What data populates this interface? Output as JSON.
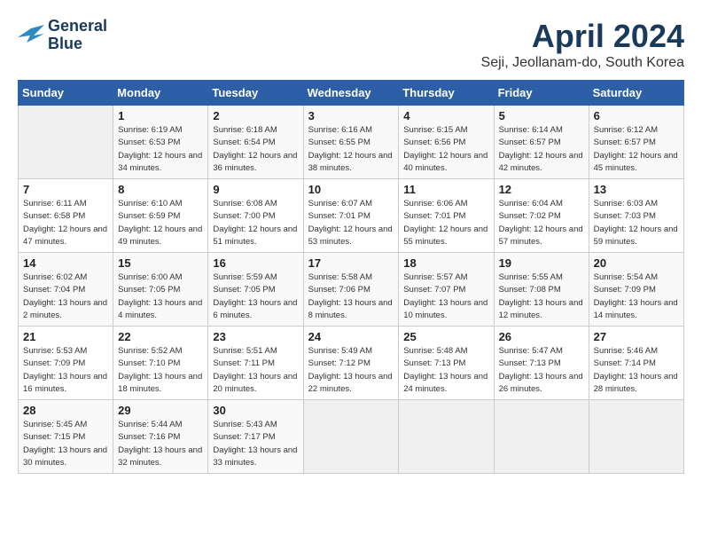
{
  "header": {
    "logo_line1": "General",
    "logo_line2": "Blue",
    "title": "April 2024",
    "location": "Seji, Jeollanam-do, South Korea"
  },
  "weekdays": [
    "Sunday",
    "Monday",
    "Tuesday",
    "Wednesday",
    "Thursday",
    "Friday",
    "Saturday"
  ],
  "weeks": [
    [
      {
        "day": "",
        "sunrise": "",
        "sunset": "",
        "daylight": ""
      },
      {
        "day": "1",
        "sunrise": "Sunrise: 6:19 AM",
        "sunset": "Sunset: 6:53 PM",
        "daylight": "Daylight: 12 hours and 34 minutes."
      },
      {
        "day": "2",
        "sunrise": "Sunrise: 6:18 AM",
        "sunset": "Sunset: 6:54 PM",
        "daylight": "Daylight: 12 hours and 36 minutes."
      },
      {
        "day": "3",
        "sunrise": "Sunrise: 6:16 AM",
        "sunset": "Sunset: 6:55 PM",
        "daylight": "Daylight: 12 hours and 38 minutes."
      },
      {
        "day": "4",
        "sunrise": "Sunrise: 6:15 AM",
        "sunset": "Sunset: 6:56 PM",
        "daylight": "Daylight: 12 hours and 40 minutes."
      },
      {
        "day": "5",
        "sunrise": "Sunrise: 6:14 AM",
        "sunset": "Sunset: 6:57 PM",
        "daylight": "Daylight: 12 hours and 42 minutes."
      },
      {
        "day": "6",
        "sunrise": "Sunrise: 6:12 AM",
        "sunset": "Sunset: 6:57 PM",
        "daylight": "Daylight: 12 hours and 45 minutes."
      }
    ],
    [
      {
        "day": "7",
        "sunrise": "Sunrise: 6:11 AM",
        "sunset": "Sunset: 6:58 PM",
        "daylight": "Daylight: 12 hours and 47 minutes."
      },
      {
        "day": "8",
        "sunrise": "Sunrise: 6:10 AM",
        "sunset": "Sunset: 6:59 PM",
        "daylight": "Daylight: 12 hours and 49 minutes."
      },
      {
        "day": "9",
        "sunrise": "Sunrise: 6:08 AM",
        "sunset": "Sunset: 7:00 PM",
        "daylight": "Daylight: 12 hours and 51 minutes."
      },
      {
        "day": "10",
        "sunrise": "Sunrise: 6:07 AM",
        "sunset": "Sunset: 7:01 PM",
        "daylight": "Daylight: 12 hours and 53 minutes."
      },
      {
        "day": "11",
        "sunrise": "Sunrise: 6:06 AM",
        "sunset": "Sunset: 7:01 PM",
        "daylight": "Daylight: 12 hours and 55 minutes."
      },
      {
        "day": "12",
        "sunrise": "Sunrise: 6:04 AM",
        "sunset": "Sunset: 7:02 PM",
        "daylight": "Daylight: 12 hours and 57 minutes."
      },
      {
        "day": "13",
        "sunrise": "Sunrise: 6:03 AM",
        "sunset": "Sunset: 7:03 PM",
        "daylight": "Daylight: 12 hours and 59 minutes."
      }
    ],
    [
      {
        "day": "14",
        "sunrise": "Sunrise: 6:02 AM",
        "sunset": "Sunset: 7:04 PM",
        "daylight": "Daylight: 13 hours and 2 minutes."
      },
      {
        "day": "15",
        "sunrise": "Sunrise: 6:00 AM",
        "sunset": "Sunset: 7:05 PM",
        "daylight": "Daylight: 13 hours and 4 minutes."
      },
      {
        "day": "16",
        "sunrise": "Sunrise: 5:59 AM",
        "sunset": "Sunset: 7:05 PM",
        "daylight": "Daylight: 13 hours and 6 minutes."
      },
      {
        "day": "17",
        "sunrise": "Sunrise: 5:58 AM",
        "sunset": "Sunset: 7:06 PM",
        "daylight": "Daylight: 13 hours and 8 minutes."
      },
      {
        "day": "18",
        "sunrise": "Sunrise: 5:57 AM",
        "sunset": "Sunset: 7:07 PM",
        "daylight": "Daylight: 13 hours and 10 minutes."
      },
      {
        "day": "19",
        "sunrise": "Sunrise: 5:55 AM",
        "sunset": "Sunset: 7:08 PM",
        "daylight": "Daylight: 13 hours and 12 minutes."
      },
      {
        "day": "20",
        "sunrise": "Sunrise: 5:54 AM",
        "sunset": "Sunset: 7:09 PM",
        "daylight": "Daylight: 13 hours and 14 minutes."
      }
    ],
    [
      {
        "day": "21",
        "sunrise": "Sunrise: 5:53 AM",
        "sunset": "Sunset: 7:09 PM",
        "daylight": "Daylight: 13 hours and 16 minutes."
      },
      {
        "day": "22",
        "sunrise": "Sunrise: 5:52 AM",
        "sunset": "Sunset: 7:10 PM",
        "daylight": "Daylight: 13 hours and 18 minutes."
      },
      {
        "day": "23",
        "sunrise": "Sunrise: 5:51 AM",
        "sunset": "Sunset: 7:11 PM",
        "daylight": "Daylight: 13 hours and 20 minutes."
      },
      {
        "day": "24",
        "sunrise": "Sunrise: 5:49 AM",
        "sunset": "Sunset: 7:12 PM",
        "daylight": "Daylight: 13 hours and 22 minutes."
      },
      {
        "day": "25",
        "sunrise": "Sunrise: 5:48 AM",
        "sunset": "Sunset: 7:13 PM",
        "daylight": "Daylight: 13 hours and 24 minutes."
      },
      {
        "day": "26",
        "sunrise": "Sunrise: 5:47 AM",
        "sunset": "Sunset: 7:13 PM",
        "daylight": "Daylight: 13 hours and 26 minutes."
      },
      {
        "day": "27",
        "sunrise": "Sunrise: 5:46 AM",
        "sunset": "Sunset: 7:14 PM",
        "daylight": "Daylight: 13 hours and 28 minutes."
      }
    ],
    [
      {
        "day": "28",
        "sunrise": "Sunrise: 5:45 AM",
        "sunset": "Sunset: 7:15 PM",
        "daylight": "Daylight: 13 hours and 30 minutes."
      },
      {
        "day": "29",
        "sunrise": "Sunrise: 5:44 AM",
        "sunset": "Sunset: 7:16 PM",
        "daylight": "Daylight: 13 hours and 32 minutes."
      },
      {
        "day": "30",
        "sunrise": "Sunrise: 5:43 AM",
        "sunset": "Sunset: 7:17 PM",
        "daylight": "Daylight: 13 hours and 33 minutes."
      },
      {
        "day": "",
        "sunrise": "",
        "sunset": "",
        "daylight": ""
      },
      {
        "day": "",
        "sunrise": "",
        "sunset": "",
        "daylight": ""
      },
      {
        "day": "",
        "sunrise": "",
        "sunset": "",
        "daylight": ""
      },
      {
        "day": "",
        "sunrise": "",
        "sunset": "",
        "daylight": ""
      }
    ]
  ]
}
